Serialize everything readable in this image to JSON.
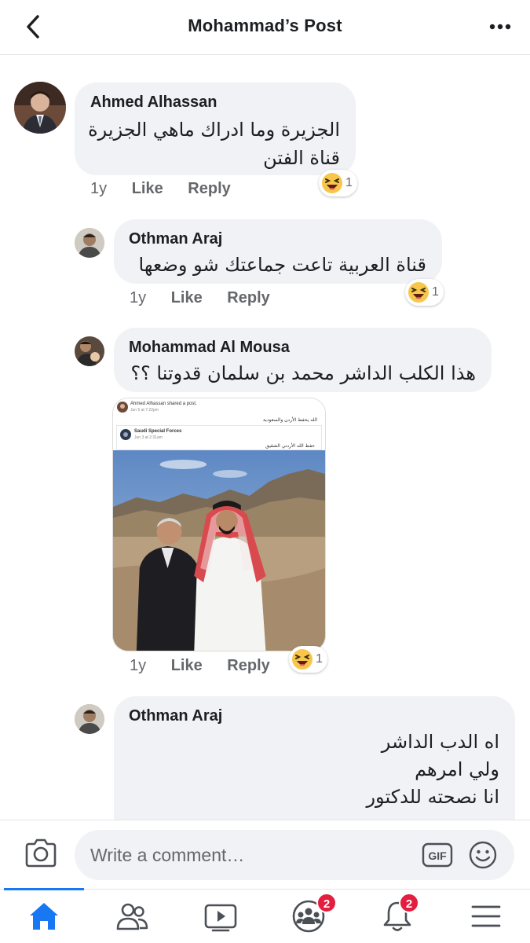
{
  "header": {
    "title": "Mohammad’s Post"
  },
  "comments": [
    {
      "author": "Ahmed Alhassan",
      "lines": [
        "الجزيرة وما ادراك ماهي الجزيرة",
        "قناة الفتن"
      ],
      "time": "1y",
      "like": "Like",
      "reply": "Reply",
      "reaction_count": "1"
    },
    {
      "author": "Othman Araj",
      "lines": [
        "قناة العربية تاعت جماعتك شو وضعها"
      ],
      "time": "1y",
      "like": "Like",
      "reply": "Reply",
      "reaction_count": "1"
    },
    {
      "author": "Mohammad Al Mousa",
      "lines": [
        "هذا الكلب الداشر محمد بن سلمان قدوتنا ؟؟"
      ],
      "time": "1y",
      "like": "Like",
      "reply": "Reply",
      "reaction_count": "1",
      "shared": {
        "author": "Ahmed Alhassan shared a post.",
        "date": "Jun 5 at 7:22pm",
        "caption": "الله يحفظ الأردن والسعودية",
        "inner_name": "Saudi Special Forces",
        "inner_date": "Jun 3 at 2:31am",
        "inner_caption": "حفظ الله الأردني الشقيق"
      }
    },
    {
      "author": "Othman Araj",
      "lines": [
        "اه الدب الداشر",
        "ولي امرهم",
        "انا نصحته للدكتور"
      ]
    }
  ],
  "composer": {
    "placeholder": "Write a comment…",
    "gif_label": "GIF"
  },
  "tabs": {
    "groups_badge": "2",
    "notifications_badge": "2"
  }
}
